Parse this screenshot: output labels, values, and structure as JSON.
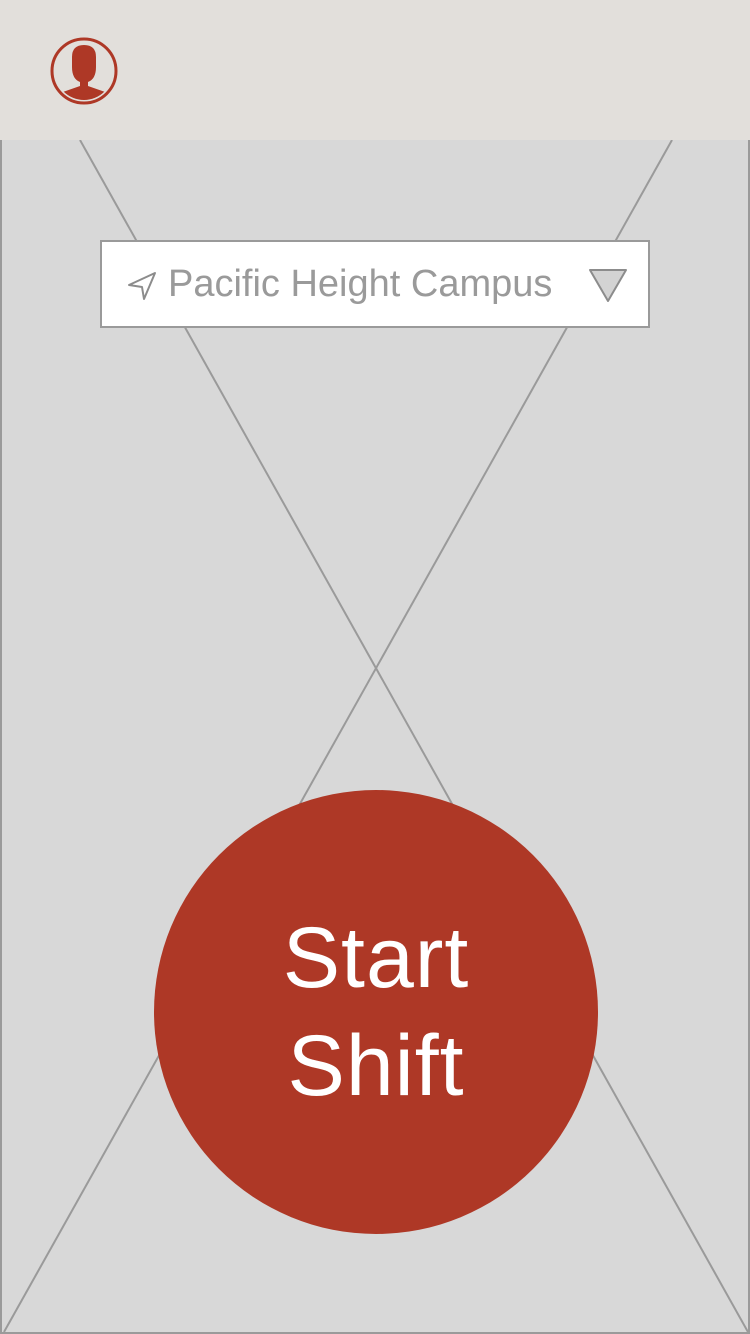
{
  "header": {
    "avatar_icon": "user-avatar-icon"
  },
  "location_selector": {
    "icon": "navigation-arrow-icon",
    "label": "Pacific Height Campus",
    "dropdown_icon": "triangle-down-icon"
  },
  "start_button": {
    "line1": "Start",
    "line2": "Shift"
  },
  "colors": {
    "accent": "#ae3826",
    "header_bg": "#e2dfdb",
    "map_bg": "#d8d8d8",
    "placeholder_line": "#9a9a9a"
  }
}
